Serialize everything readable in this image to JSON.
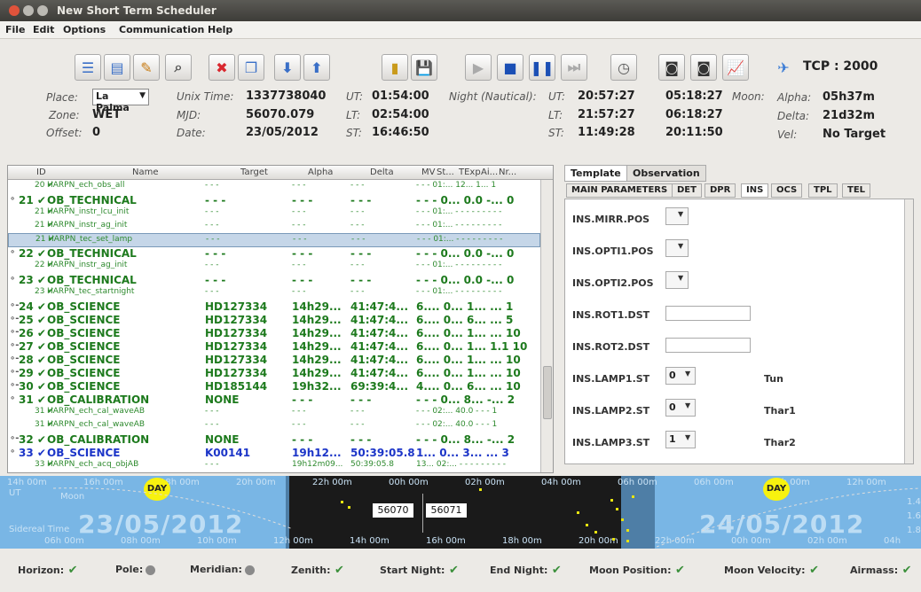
{
  "window": {
    "title": "New Short Term Scheduler"
  },
  "menu": [
    "File",
    "Edit",
    "Options",
    "Communication",
    "Help"
  ],
  "toolbar": {
    "icons": [
      "list-icon",
      "details-icon",
      "edit-icon",
      "search-icon",
      "stop-red-icon",
      "copy-icon",
      "arrow-down-icon",
      "arrow-up-icon",
      "open-icon",
      "save-icon",
      "play-icon",
      "stop-icon",
      "pause-icon",
      "skip-icon",
      "clock-icon",
      "camera-icon",
      "camera2-icon",
      "chart-icon",
      "satellite-icon"
    ],
    "tcp": "TCP : 2000"
  },
  "info": {
    "place_label": "Place:",
    "place_value": "La Palma",
    "zone_label": "Zone:",
    "zone_value": "WET",
    "offset_label": "Offset:",
    "offset_value": "0",
    "unix_label": "Unix Time:",
    "unix_value": "1337738040",
    "mjd_label": "MJD:",
    "mjd_value": "56070.079",
    "date_label": "Date:",
    "date_value": "23/05/2012",
    "ut_label": "UT:",
    "ut_value": "01:54:00",
    "lt_label": "LT:",
    "lt_value": "02:54:00",
    "st_label": "ST:",
    "st_value": "16:46:50",
    "night_label": "Night (Nautical):",
    "n_ut_label": "UT:",
    "n_ut_1": "20:57:27",
    "n_ut_2": "05:18:27",
    "n_lt_label": "LT:",
    "n_lt_1": "21:57:27",
    "n_lt_2": "06:18:27",
    "n_st_label": "ST:",
    "n_st_1": "11:49:28",
    "n_st_2": "20:11:50",
    "moon_label": "Moon:",
    "alpha_label": "Alpha:",
    "alpha_value": "05h37m",
    "delta_label": "Delta:",
    "delta_value": "21d32m",
    "vel_label": "Vel:",
    "vel_value": "No Target"
  },
  "table": {
    "headers": [
      "ID",
      "Name",
      "Target",
      "Alpha",
      "Delta",
      "MV",
      "St...",
      "TExp",
      "Ai...",
      "Nr..."
    ],
    "rows": [
      {
        "id": "20 ✔",
        "name": "HARPN_ech_obs_all",
        "target": "- - -",
        "alpha": "- - -",
        "delta": "- - -",
        "rest": "- - -  01:... 12...  1...  1",
        "kind": "small"
      },
      {
        "id": "21 ✔",
        "name": "OB_TECHNICAL",
        "target": "- - -",
        "alpha": "- - -",
        "delta": "- - -",
        "rest": "- - - 0... 0.0  -... 0",
        "kind": "big",
        "tw": "∘"
      },
      {
        "id": "21 ✔",
        "name": "HARPN_instr_lcu_init",
        "target": "- - -",
        "alpha": "- - -",
        "delta": "- - -",
        "rest": "- - -  01:... - - -  - - - - - -",
        "kind": "small"
      },
      {
        "id": "21 ✔",
        "name": "HARPN_instr_ag_init",
        "target": "- - -",
        "alpha": "- - -",
        "delta": "- - -",
        "rest": "- - -  01:... - - -  - - - - - -",
        "kind": "small"
      },
      {
        "id": "21 ✔",
        "name": "HARPN_tec_set_lamp",
        "target": "- - -",
        "alpha": "- - -",
        "delta": "- - -",
        "rest": "- - -  01:... - - -  - - - - - -",
        "kind": "small",
        "sel": true
      },
      {
        "id": "22 ✔",
        "name": "OB_TECHNICAL",
        "target": "- - -",
        "alpha": "- - -",
        "delta": "- - -",
        "rest": "- - - 0... 0.0  -... 0",
        "kind": "big",
        "tw": "∘"
      },
      {
        "id": "22 ✔",
        "name": "HARPN_instr_ag_init",
        "target": "- - -",
        "alpha": "- - -",
        "delta": "- - -",
        "rest": "- - -  01:... - - -  - - - - - -",
        "kind": "small"
      },
      {
        "id": "23 ✔",
        "name": "OB_TECHNICAL",
        "target": "- - -",
        "alpha": "- - -",
        "delta": "- - -",
        "rest": "- - - 0... 0.0  -... 0",
        "kind": "big",
        "tw": "∘"
      },
      {
        "id": "23 ✔",
        "name": "HARPN_tec_startnight",
        "target": "- - -",
        "alpha": "- - -",
        "delta": "- - -",
        "rest": "- - -  01:... - - -  - - - - - -",
        "kind": "small"
      },
      {
        "id": "24 ✔",
        "name": "OB_SCIENCE",
        "target": "HD127334",
        "alpha": "14h29...",
        "delta": "41:47:4...",
        "rest": "6.... 0... 1... ... 1",
        "kind": "big",
        "tw": "∘-"
      },
      {
        "id": "25 ✔",
        "name": "OB_SCIENCE",
        "target": "HD127334",
        "alpha": "14h29...",
        "delta": "41:47:4...",
        "rest": "6.... 0... 6... ... 5",
        "kind": "big",
        "tw": "∘-"
      },
      {
        "id": "26 ✔",
        "name": "OB_SCIENCE",
        "target": "HD127334",
        "alpha": "14h29...",
        "delta": "41:47:4...",
        "rest": "6.... 0... 1... ... 10",
        "kind": "big",
        "tw": "∘-"
      },
      {
        "id": "27 ✔",
        "name": "OB_SCIENCE",
        "target": "HD127334",
        "alpha": "14h29...",
        "delta": "41:47:4...",
        "rest": "6.... 0... 1... 1.1 10",
        "kind": "big",
        "tw": "∘-"
      },
      {
        "id": "28 ✔",
        "name": "OB_SCIENCE",
        "target": "HD127334",
        "alpha": "14h29...",
        "delta": "41:47:4...",
        "rest": "6.... 0... 1... ... 10",
        "kind": "big",
        "tw": "∘-"
      },
      {
        "id": "29 ✔",
        "name": "OB_SCIENCE",
        "target": "HD127334",
        "alpha": "14h29...",
        "delta": "41:47:4...",
        "rest": "6.... 0... 1... ... 10",
        "kind": "big",
        "tw": "∘-"
      },
      {
        "id": "30 ✔",
        "name": "OB_SCIENCE",
        "target": "HD185144",
        "alpha": "19h32...",
        "delta": "69:39:4...",
        "rest": "4.... 0... 6... ... 10",
        "kind": "big",
        "tw": "∘-"
      },
      {
        "id": "31 ✔",
        "name": "OB_CALIBRATION",
        "target": "NONE",
        "alpha": "- - -",
        "delta": "- - -",
        "rest": "- - - 0... 8... -... 2",
        "kind": "big",
        "tw": "∘"
      },
      {
        "id": "31 ✔",
        "name": "HARPN_ech_cal_waveAB",
        "target": "- - -",
        "alpha": "- - -",
        "delta": "- - -",
        "rest": "- - -  02:... 40.0  - - -  1",
        "kind": "small"
      },
      {
        "id": "31 ✔",
        "name": "HARPN_ech_cal_waveAB",
        "target": "- - -",
        "alpha": "- - -",
        "delta": "- - -",
        "rest": "- - -  02:... 40.0  - - -  1",
        "kind": "small"
      },
      {
        "id": "32 ✔",
        "name": "OB_CALIBRATION",
        "target": "NONE",
        "alpha": "- - -",
        "delta": "- - -",
        "rest": "- - - 0... 8... -... 2",
        "kind": "big",
        "tw": "∘-"
      },
      {
        "id": "33 ✔",
        "name": "OB_SCIENCE",
        "target": "K00141",
        "alpha": "19h12...",
        "delta": "50:39:05.8",
        "rest": "1... 0... 3... ... 3",
        "kind": "blue",
        "tw": "∘"
      },
      {
        "id": "33 ✔",
        "name": "HARPN_ech_acq_objAB",
        "target": "- - -",
        "alpha": "19h12m09...",
        "delta": "50:39:05.8",
        "rest": "13...  02:... - - -  - - - - - -",
        "kind": "small"
      }
    ]
  },
  "panel": {
    "tabs": [
      "Template",
      "Observation"
    ],
    "subtabs": [
      "MAIN PARAMETERS",
      "DET",
      "DPR",
      "INS",
      "OCS",
      "TPL",
      "TEL"
    ],
    "params": [
      {
        "label": "INS.MIRR.POS",
        "type": "combo",
        "value": "",
        "extra": ""
      },
      {
        "label": "INS.OPTI1.POS",
        "type": "combo",
        "value": "",
        "extra": ""
      },
      {
        "label": "INS.OPTI2.POS",
        "type": "combo",
        "value": "",
        "extra": ""
      },
      {
        "label": "INS.ROT1.DST",
        "type": "text",
        "value": "",
        "extra": ""
      },
      {
        "label": "INS.ROT2.DST",
        "type": "text",
        "value": "",
        "extra": ""
      },
      {
        "label": "INS.LAMP1.ST",
        "type": "combo",
        "value": "0",
        "extra": "Tun"
      },
      {
        "label": "INS.LAMP2.ST",
        "type": "combo",
        "value": "0",
        "extra": "Thar1"
      },
      {
        "label": "INS.LAMP3.ST",
        "type": "combo",
        "value": "1",
        "extra": "Thar2"
      }
    ]
  },
  "timeline": {
    "top_ticks": [
      "14h 00m",
      "16h 00m",
      "18h 00m",
      "20h 00m",
      "22h 00m",
      "00h 00m",
      "02h 00m",
      "04h 00m",
      "06h 00m",
      "06h 00m",
      "10h 00m",
      "12h 00m"
    ],
    "bottom_ticks": [
      "06h 00m",
      "08h 00m",
      "10h 00m",
      "12h 00m",
      "14h 00m",
      "16h 00m",
      "18h 00m",
      "20h 00m",
      "22h 00m",
      "00h 00m",
      "02h 00m",
      "04h"
    ],
    "ut_label": "UT",
    "moon_label": "Moon",
    "sidereal_label": "Sidereal Time",
    "date_left": "23/05/2012",
    "date_right": "24/05/2012",
    "mjd_left": "56070",
    "mjd_right": "56071",
    "day_label": "DAY",
    "right_scale": [
      "1.4",
      "1.6",
      "1.8"
    ]
  },
  "status": [
    {
      "label": "Horizon:",
      "state": "ok"
    },
    {
      "label": "Pole:",
      "state": "grey"
    },
    {
      "label": "Meridian:",
      "state": "grey"
    },
    {
      "label": "Zenith:",
      "state": "ok"
    },
    {
      "label": "Start Night:",
      "state": "ok"
    },
    {
      "label": "End Night:",
      "state": "ok"
    },
    {
      "label": "Moon Position:",
      "state": "ok"
    },
    {
      "label": "Moon Velocity:",
      "state": "ok"
    },
    {
      "label": "Airmass:",
      "state": "ok"
    }
  ],
  "colors": {
    "ok": "#3a8f3a",
    "grey": "#8a8a8a",
    "sky": "#79b6e5",
    "night": "#1a1a1a"
  }
}
